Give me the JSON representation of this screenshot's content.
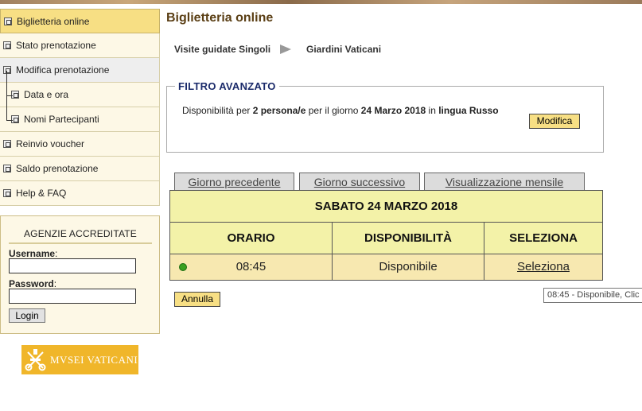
{
  "sidebar": {
    "items": [
      {
        "label": "Biglietteria online"
      },
      {
        "label": "Stato prenotazione"
      },
      {
        "label": "Modifica prenotazione"
      },
      {
        "label": "Data e ora"
      },
      {
        "label": "Nomi Partecipanti"
      },
      {
        "label": "Reinvio voucher"
      },
      {
        "label": "Saldo prenotazione"
      },
      {
        "label": "Help & FAQ"
      }
    ]
  },
  "agency": {
    "title": "AGENZIE ACCREDITATE",
    "username_label": "Username",
    "password_label": "Password",
    "username_value": "",
    "password_value": "",
    "login_label": "Login"
  },
  "logo": {
    "text": "MVSEI VATICANI"
  },
  "main": {
    "title": "Biglietteria online",
    "breadcrumb": [
      "Visite guidate Singoli",
      "Giardini Vaticani"
    ]
  },
  "filter": {
    "legend": "FILTRO AVANZATO",
    "text_prefix": "Disponibilità per ",
    "persons": "2 persona/e",
    "text_mid": " per il giorno ",
    "date": "24 Marzo 2018",
    "text_in": " in ",
    "language": "lingua Russo",
    "modify_label": "Modifica"
  },
  "tabs": [
    "Giorno precedente",
    "Giorno successivo",
    "Visualizzazione mensile"
  ],
  "schedule": {
    "day_header": "SABATO 24 MARZO 2018",
    "columns": [
      "ORARIO",
      "DISPONIBILITÀ",
      "SELEZIONA"
    ],
    "rows": [
      {
        "time": "08:45",
        "availability": "Disponibile",
        "action": "Seleziona",
        "status_color": "#3aa020"
      }
    ]
  },
  "cancel_label": "Annulla",
  "tooltip": "08:45 - Disponibile, Clic"
}
